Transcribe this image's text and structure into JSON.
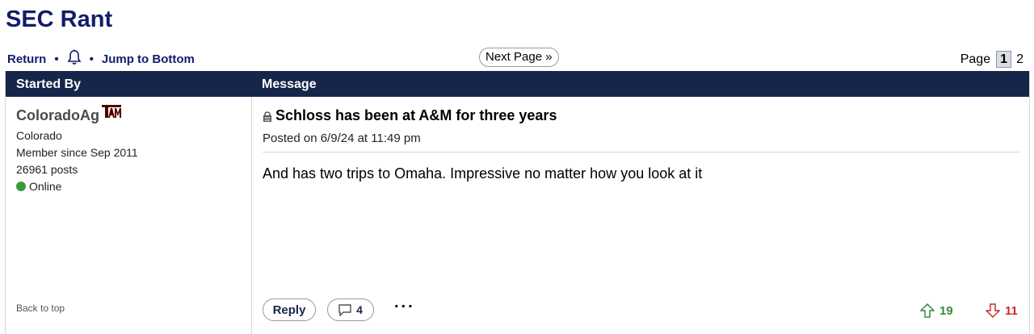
{
  "board": {
    "title": "SEC Rant"
  },
  "nav": {
    "return_label": "Return",
    "jump_label": "Jump to Bottom",
    "separator": "•"
  },
  "pagination": {
    "next_label": "Next Page »",
    "page_label": "Page",
    "current_page": "1",
    "other_page": "2"
  },
  "table": {
    "header_author": "Started By",
    "header_message": "Message"
  },
  "post": {
    "author": {
      "username": "ColoradoAg",
      "location": "Colorado",
      "member_since": "Member since Sep 2011",
      "posts": "26961 posts",
      "status": "Online",
      "status_color": "#3c9a3c",
      "team_logo": "texas-am-logo"
    },
    "title": "Schloss has been at A&M for three years",
    "posted": "Posted on 6/9/24 at 11:49 pm",
    "body": "And has two trips to Omaha. Impressive no matter how you look at it",
    "back_to_top": "Back to top",
    "reply_label": "Reply",
    "reply_count": "4",
    "more_label": "...",
    "upvotes": "19",
    "downvotes": "11"
  },
  "colors": {
    "header_bg": "#16264a",
    "title": "#121c6b",
    "upvote": "#3d8a3d",
    "downvote": "#c92b2b",
    "team_maroon": "#500000"
  }
}
